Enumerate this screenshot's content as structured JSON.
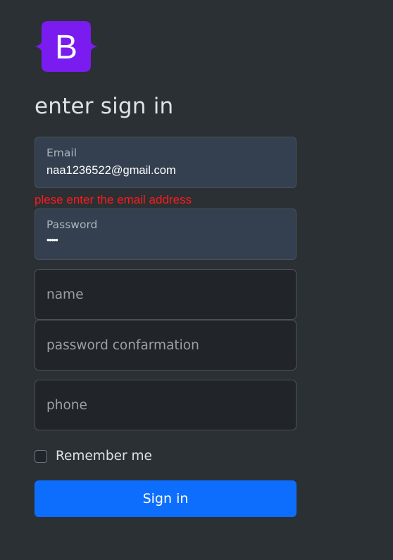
{
  "brand": {
    "logo_letter": "B",
    "logo_color": "#7a1cf0"
  },
  "form": {
    "title": "enter sign in",
    "email": {
      "label": "Email",
      "value": "naa1236522@gmail.com"
    },
    "error": "plese enter the email address",
    "password": {
      "label": "Password",
      "value": "•••••"
    },
    "name": {
      "placeholder": "name"
    },
    "password_confirmation": {
      "placeholder": "password confarmation"
    },
    "phone": {
      "placeholder": "phone"
    },
    "remember_label": "Remember me",
    "submit_label": "Sign in"
  },
  "colors": {
    "background": "#2b3035",
    "filled_field": "#344050",
    "empty_field": "#212529",
    "error": "#ff1a1a",
    "primary": "#0d6efd"
  }
}
